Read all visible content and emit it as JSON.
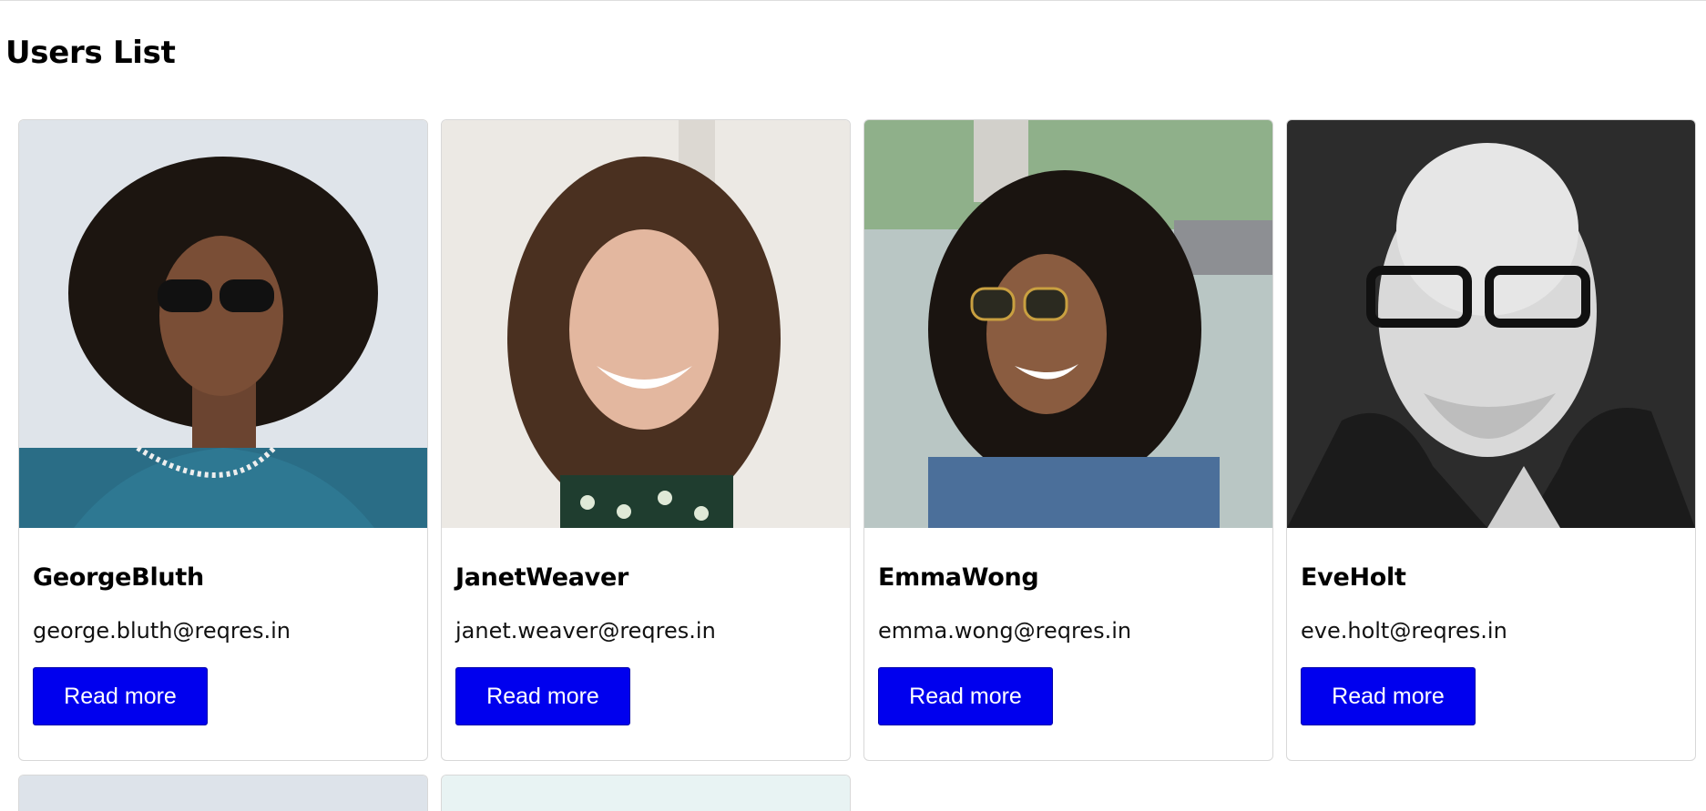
{
  "page": {
    "title": "Users List"
  },
  "users": [
    {
      "name": "GeorgeBluth",
      "email": "george.bluth@reqres.in",
      "button": "Read more",
      "photo_theme": "#e4e8ee"
    },
    {
      "name": "JanetWeaver",
      "email": "janet.weaver@reqres.in",
      "button": "Read more",
      "photo_theme": "#e9e6e1"
    },
    {
      "name": "EmmaWong",
      "email": "emma.wong@reqres.in",
      "button": "Read more",
      "photo_theme": "#c9d3cf"
    },
    {
      "name": "EveHolt",
      "email": "eve.holt@reqres.in",
      "button": "Read more",
      "photo_theme": "#3a3a3a"
    }
  ],
  "colors": {
    "button_bg": "#0000ee",
    "button_text": "#ffffff",
    "card_border": "#d8d8d8"
  }
}
